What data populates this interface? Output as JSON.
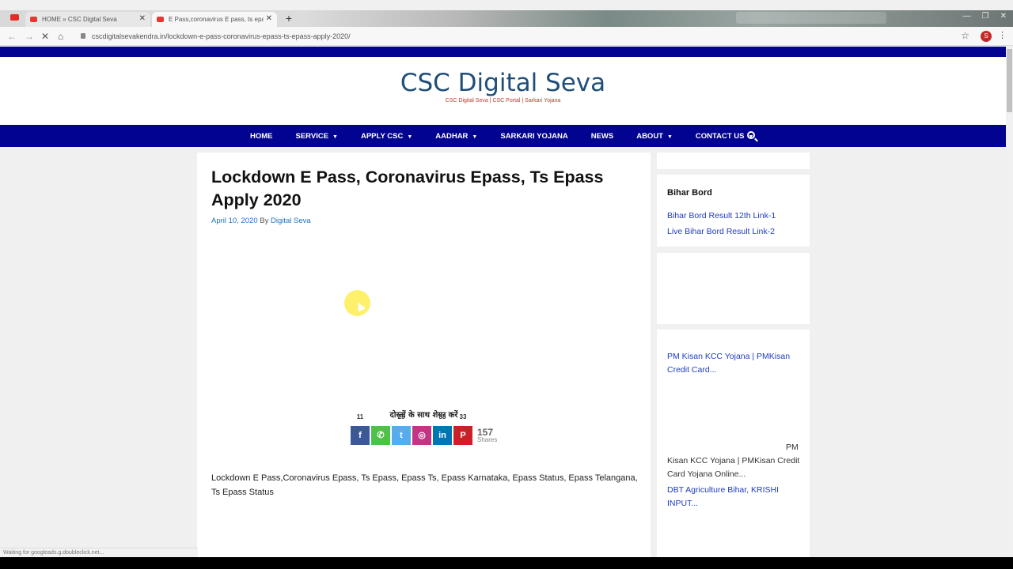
{
  "browser": {
    "tabs": [
      {
        "title": "HOME » CSC Digital Seva",
        "active": false
      },
      {
        "title": "E Pass,coronavirus E pass, ts epass",
        "active": true
      }
    ],
    "url": "cscdigitalsevakendra.in/lockdown-e-pass-coronavirus-epass-ts-epass-apply-2020/",
    "profile_initial": "S",
    "status_text": "Waiting for googleads.g.doubleclick.net..."
  },
  "site": {
    "title": "CSC Digital Seva",
    "tagline": "CSC Digital Seva | CSC Portal | Sarkari Yojana",
    "accent_color": "#030391"
  },
  "nav": {
    "items": [
      {
        "label": "HOME",
        "caret": false
      },
      {
        "label": "SERVICE",
        "caret": true
      },
      {
        "label": "APPLY CSC",
        "caret": true
      },
      {
        "label": "AADHAR",
        "caret": true
      },
      {
        "label": "SARKARI YOJANA",
        "caret": false
      },
      {
        "label": "NEWS",
        "caret": false
      },
      {
        "label": "ABOUT",
        "caret": true
      },
      {
        "label": "CONTACT US",
        "caret": true
      }
    ]
  },
  "article": {
    "title": "Lockdown E Pass, Coronavirus Epass, Ts Epass Apply 2020",
    "date": "April 10, 2020",
    "by": "By",
    "author": "Digital Seva",
    "share_heading": "दोस्तों के साथ शेयर करें",
    "share_buttons": [
      {
        "network": "facebook",
        "glyph": "f",
        "count": "11",
        "color": "#3b5998"
      },
      {
        "network": "whatsapp",
        "glyph": "✆",
        "count": "",
        "color": "#4dc247"
      },
      {
        "network": "twitter",
        "glyph": "t",
        "count": "25",
        "color": "#55acee"
      },
      {
        "network": "instagram",
        "glyph": "◎",
        "count": "",
        "color": "#c13584"
      },
      {
        "network": "linkedin",
        "glyph": "in",
        "count": "88",
        "color": "#0077b5"
      },
      {
        "network": "pinterest",
        "glyph": "P",
        "count": "33",
        "color": "#cb2027"
      }
    ],
    "total_shares": "157",
    "shares_label": "Shares",
    "body": "Lockdown E Pass,Coronavirus Epass, Ts Epass, Epass Ts, Epass Karnataka, Epass Status, Epass Telangana, Ts Epass Status"
  },
  "sidebar": {
    "bihar": {
      "title": "Bihar Bord",
      "links": [
        "Bihar Bord Result 12th Link-1",
        "Live Bihar Bord Result Link-2"
      ]
    },
    "posts": {
      "link1": "PM Kisan KCC Yojana | PMKisan Credit Card...",
      "pm": "PM",
      "text2": "Kisan KCC Yojana | PMKisan Credit Card Yojana Online...",
      "link3": "DBT Agriculture Bihar, KRISHI INPUT..."
    }
  }
}
